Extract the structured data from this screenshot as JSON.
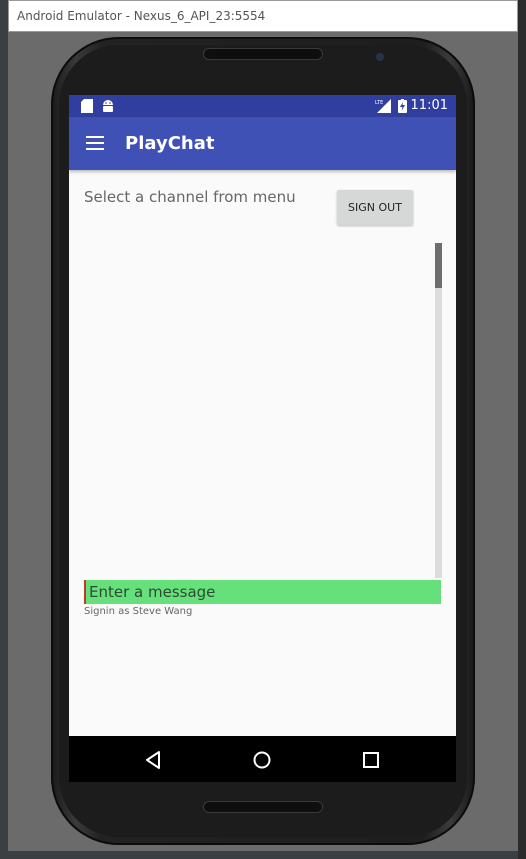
{
  "window": {
    "title": "Android Emulator - Nexus_6_API_23:5554"
  },
  "statusbar": {
    "time": "11:01",
    "icons": [
      "sd-card-icon",
      "android-icon",
      "lte-signal-icon",
      "battery-charging-icon"
    ]
  },
  "appbar": {
    "title": "PlayChat",
    "menu_icon": "hamburger-menu-icon"
  },
  "main": {
    "channel_label": "Select a channel from menu",
    "signout_label": "SIGN OUT",
    "message_placeholder": "Enter a message",
    "signin_status": "Signin as Steve Wang"
  },
  "navbar": {
    "buttons": [
      "back-icon",
      "home-icon",
      "recents-icon"
    ]
  },
  "colors": {
    "statusbar": "#303f9f",
    "appbar": "#3f51b5",
    "input_bg": "#66e07b"
  }
}
